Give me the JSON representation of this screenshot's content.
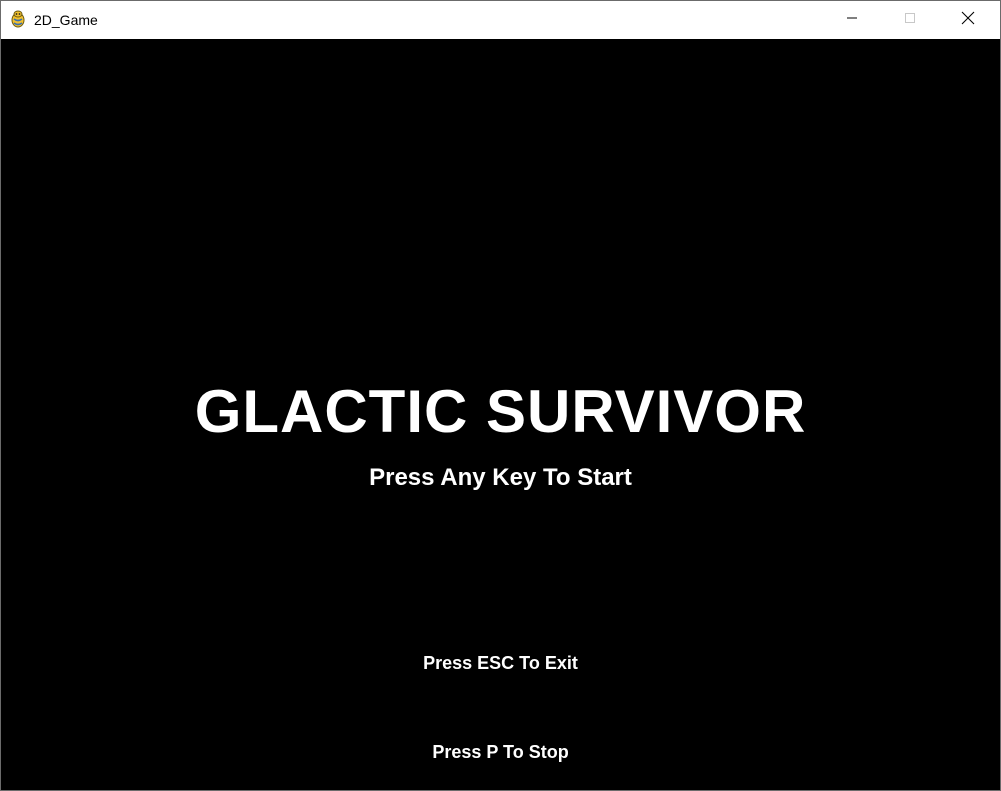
{
  "window": {
    "title": "2D_Game",
    "icon": "pygame-snake-icon",
    "controls": {
      "minimize_icon": "minimize-icon",
      "maximize_icon": "maximize-icon",
      "close_icon": "close-icon"
    }
  },
  "game": {
    "title": "GLACTIC SURVIVOR",
    "start_prompt": "Press Any Key To Start",
    "exit_prompt": "Press ESC To Exit",
    "stop_prompt": "Press P To Stop",
    "colors": {
      "background": "#000000",
      "text": "#ffffff"
    }
  }
}
